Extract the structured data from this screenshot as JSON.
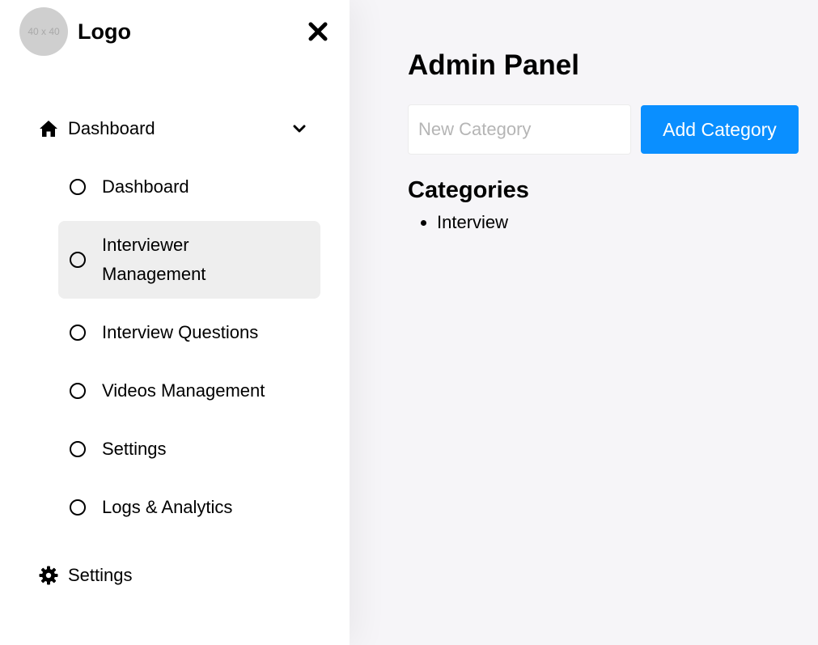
{
  "sidebar": {
    "avatar_text": "40 x 40",
    "logo_text": "Logo",
    "nav": {
      "dashboard_label": "Dashboard",
      "sub_items": [
        {
          "label": "Dashboard"
        },
        {
          "label": "Interviewer\nManagement",
          "line1": "Interviewer",
          "line2": "Management",
          "active": true
        },
        {
          "label": "Interview Questions"
        },
        {
          "label": "Videos Management"
        },
        {
          "label": "Settings"
        },
        {
          "label": "Logs & Analytics"
        }
      ],
      "settings_label": "Settings"
    },
    "icons": {
      "close": "close-icon",
      "home": "home-icon",
      "chevron": "chevron-down-icon",
      "gear": "gear-icon"
    }
  },
  "main": {
    "title": "Admin Panel",
    "input_placeholder": "New Category",
    "input_value": "",
    "add_button_label": "Add Category",
    "categories_heading": "Categories",
    "categories": [
      "Interview"
    ]
  },
  "colors": {
    "accent": "#0a8fff",
    "active_item_bg": "#eeeeee",
    "page_bg": "#f6f5f8"
  }
}
